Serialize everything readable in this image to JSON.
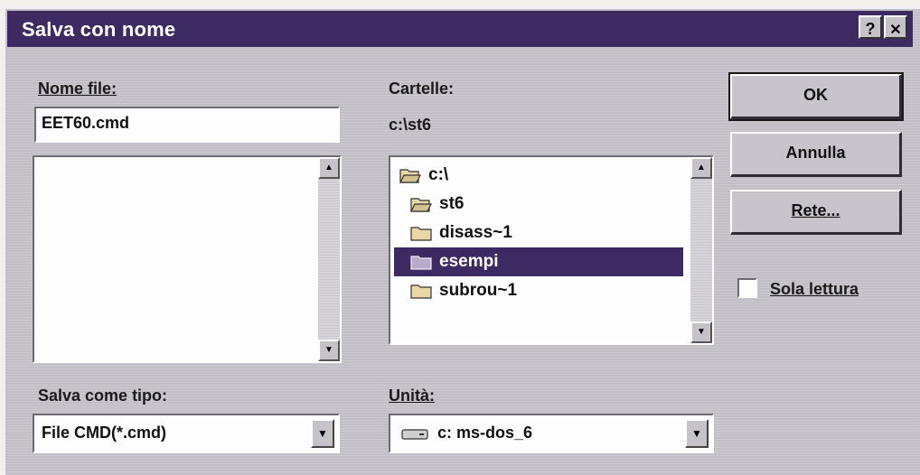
{
  "window": {
    "title": "Salva con nome",
    "help_glyph": "?",
    "close_glyph": "✕"
  },
  "filename": {
    "label": "Nome file:",
    "value": "EET60.cmd"
  },
  "folders": {
    "label": "Cartelle:",
    "current_path": "c:\\st6",
    "items": [
      {
        "name": "c:\\",
        "icon": "open-folder-icon",
        "selected": false
      },
      {
        "name": "st6",
        "icon": "open-folder-icon",
        "selected": false
      },
      {
        "name": "disass~1",
        "icon": "folder-icon",
        "selected": false
      },
      {
        "name": "esempi",
        "icon": "folder-icon",
        "selected": true
      },
      {
        "name": "subrou~1",
        "icon": "folder-icon",
        "selected": false
      }
    ]
  },
  "save_as_type": {
    "label": "Salva come tipo:",
    "value": "File CMD(*.cmd)"
  },
  "drive": {
    "label": "Unità:",
    "value": "c: ms-dos_6",
    "icon": "drive-icon"
  },
  "buttons": {
    "ok": "OK",
    "cancel": "Annulla",
    "network": "Rete..."
  },
  "readonly": {
    "label": "Sola lettura",
    "checked": false
  },
  "colors": {
    "titlebar": "#3d2a63",
    "selection": "#3d2a63",
    "face": "#c7c4cc"
  }
}
